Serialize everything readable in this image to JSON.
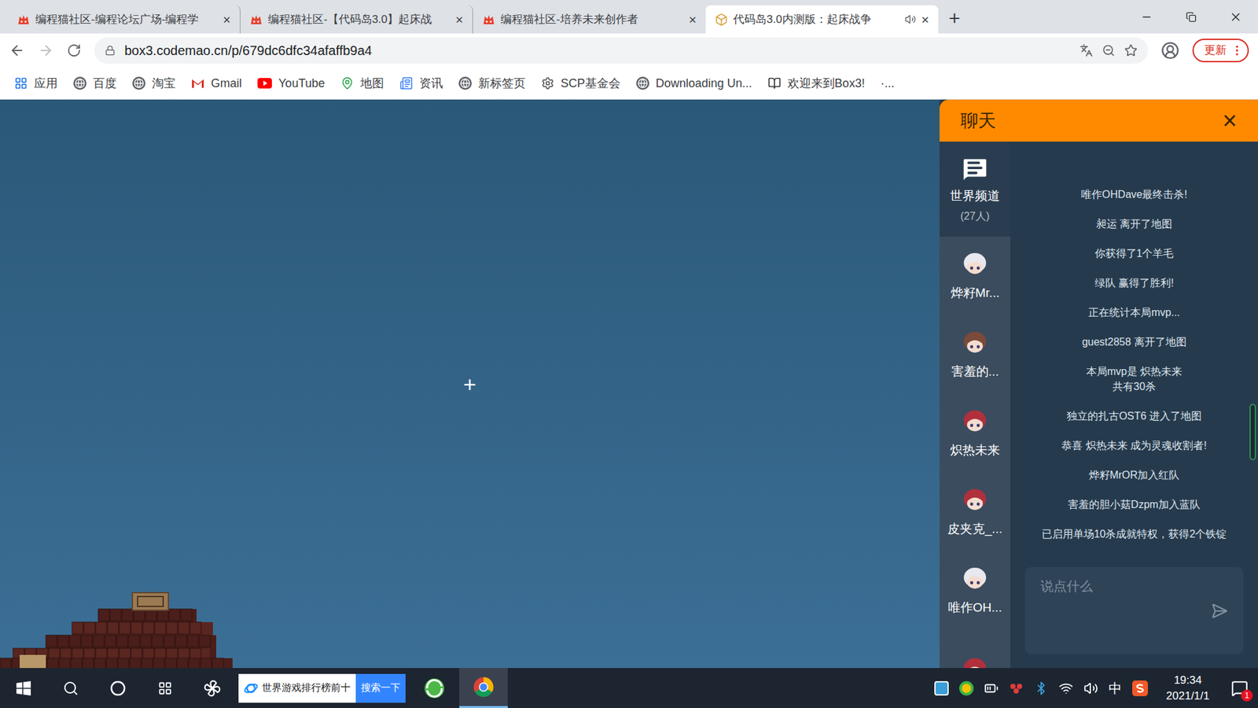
{
  "browser": {
    "tabs": [
      {
        "label": "编程猫社区-编程论坛广场-编程学",
        "selected": false,
        "kind": "codemao",
        "audio": false
      },
      {
        "label": "编程猫社区-【代码岛3.0】起床战",
        "selected": false,
        "kind": "codemao",
        "audio": false
      },
      {
        "label": "编程猫社区-培养未来创作者",
        "selected": false,
        "kind": "codemao",
        "audio": false
      },
      {
        "label": "代码岛3.0内测版：起床战争",
        "selected": true,
        "kind": "box",
        "audio": true
      }
    ],
    "tab_close": "×",
    "new_tab": "+",
    "url": "box3.codemao.cn/p/679dc6dfc34afaffb9a4",
    "update_button": "更新",
    "bookmarks": [
      {
        "label": "应用",
        "kind": "apps"
      },
      {
        "label": "百度",
        "kind": "globe"
      },
      {
        "label": "淘宝",
        "kind": "globe"
      },
      {
        "label": "Gmail",
        "kind": "gmail"
      },
      {
        "label": "YouTube",
        "kind": "youtube"
      },
      {
        "label": "地图",
        "kind": "maps"
      },
      {
        "label": "资讯",
        "kind": "news"
      },
      {
        "label": "新标签页",
        "kind": "globe"
      },
      {
        "label": "SCP基金会",
        "kind": "scp"
      },
      {
        "label": "Downloading Un...",
        "kind": "globe"
      },
      {
        "label": "欢迎来到Box3!",
        "kind": "book"
      },
      {
        "label": "·...",
        "kind": "none"
      }
    ]
  },
  "game": {
    "crosshair": "+"
  },
  "chat": {
    "title": "聊天",
    "close": "×",
    "channels": [
      {
        "kind": "channel",
        "label": "世界频道",
        "count": "(27人)",
        "selected": true,
        "color": "#ffffff"
      },
      {
        "kind": "user",
        "label": "烨籽Mr...",
        "selected": false,
        "color": "#e8e8ee"
      },
      {
        "kind": "user",
        "label": "害羞的...",
        "selected": false,
        "color": "#7a4a3a"
      },
      {
        "kind": "user",
        "label": "炽热未来",
        "selected": false,
        "color": "#b0303c"
      },
      {
        "kind": "user",
        "label": "皮夹克_...",
        "selected": false,
        "color": "#b0303c"
      },
      {
        "kind": "user",
        "label": "唯作OH...",
        "selected": false,
        "color": "#e8e8ee"
      },
      {
        "kind": "user",
        "selected": false,
        "color": "#b0303c"
      }
    ],
    "messages": [
      [
        "唯作OHDave最终击杀!"
      ],
      [
        "昶运 离开了地图"
      ],
      [
        "你获得了1个羊毛"
      ],
      [
        "绿队 赢得了胜利!"
      ],
      [
        "正在统计本局mvp..."
      ],
      [
        "guest2858 离开了地图"
      ],
      [
        "本局mvp是 炽热未来",
        "共有30杀"
      ],
      [
        "独立的扎古OST6 进入了地图"
      ],
      [
        "恭喜 炽热未来 成为灵魂收割者!"
      ],
      [
        "烨籽MrOR加入红队"
      ],
      [
        "害羞的胆小菇Dzpm加入蓝队"
      ],
      [
        "已启用单场10杀成就特权，获得2个铁锭"
      ]
    ],
    "input_placeholder": "说点什么"
  },
  "taskbar": {
    "search_text": "世界游戏排行榜前十",
    "search_button": "搜索一下",
    "ime": "中",
    "time": "19:34",
    "date": "2021/1/1",
    "notifications": "1"
  }
}
